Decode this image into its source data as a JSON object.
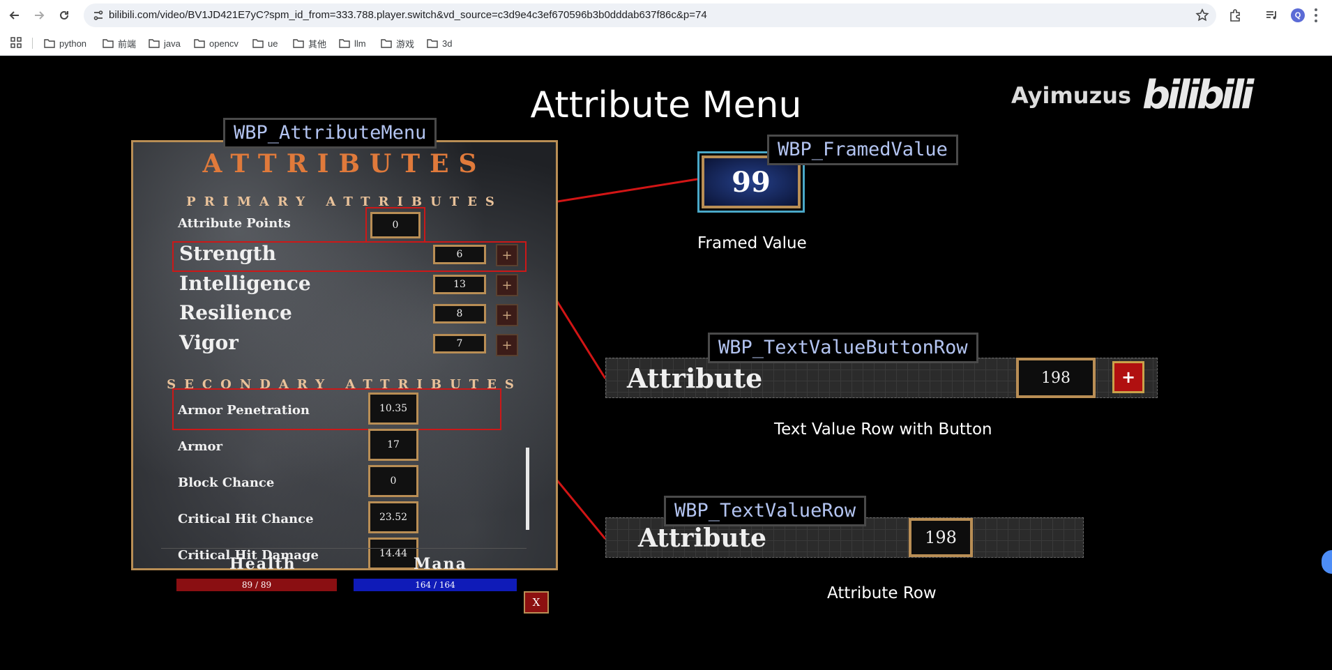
{
  "browser": {
    "url": "bilibili.com/video/BV1JD421E7yC?spm_id_from=333.788.player.switch&vd_source=c3d9e4c3ef670596b3b0dddab637f86c&p=74",
    "profile_initial": "Q",
    "bookmarks": [
      "python",
      "前端",
      "java",
      "opencv",
      "ue",
      "其他",
      "llm",
      "游戏",
      "3d"
    ]
  },
  "slide": {
    "title": "Attribute Menu",
    "watermark_name": "Ayimuzus",
    "watermark_logo": "bilibili",
    "widget_labels": {
      "attribute_menu": "WBP_AttributeMenu",
      "framed_value": "WBP_FramedValue",
      "text_value_button_row": "WBP_TextValueButtonRow",
      "text_value_row": "WBP_TextValueRow"
    },
    "captions": {
      "framed_value": "Framed Value",
      "text_value_button_row": "Text Value Row with Button",
      "attribute_row": "Attribute Row"
    }
  },
  "menu": {
    "title": "ATTRIBUTES",
    "primary_title": "PRIMARY ATTRIBUTES",
    "attribute_points_label": "Attribute Points",
    "attribute_points_value": "0",
    "primary": [
      {
        "label": "Strength",
        "value": "6"
      },
      {
        "label": "Intelligence",
        "value": "13"
      },
      {
        "label": "Resilience",
        "value": "8"
      },
      {
        "label": "Vigor",
        "value": "7"
      }
    ],
    "plus_symbol": "+",
    "secondary_title": "SECONDARY ATTRIBUTES",
    "secondary": [
      {
        "label": "Armor Penetration",
        "value": "10.35"
      },
      {
        "label": "Armor",
        "value": "17"
      },
      {
        "label": "Block Chance",
        "value": "0"
      },
      {
        "label": "Critical Hit Chance",
        "value": "23.52"
      },
      {
        "label": "Critical Hit Damage",
        "value": "14.44"
      }
    ],
    "health": {
      "label": "Health",
      "text": "89 / 89",
      "fill": 1.0
    },
    "mana": {
      "label": "Mana",
      "text": "164 / 164",
      "fill": 1.0
    },
    "close_label": "X"
  },
  "examples": {
    "framed_value": "99",
    "button_row": {
      "label": "Attribute",
      "value": "198",
      "button": "+"
    },
    "value_row": {
      "label": "Attribute",
      "value": "198"
    }
  },
  "colors": {
    "frame_gold": "#b98e55",
    "highlight_red": "#cc1818",
    "health_red": "#8a0f12",
    "mana_blue": "#0f1bb8",
    "label_blue": "#b3c4f1"
  }
}
